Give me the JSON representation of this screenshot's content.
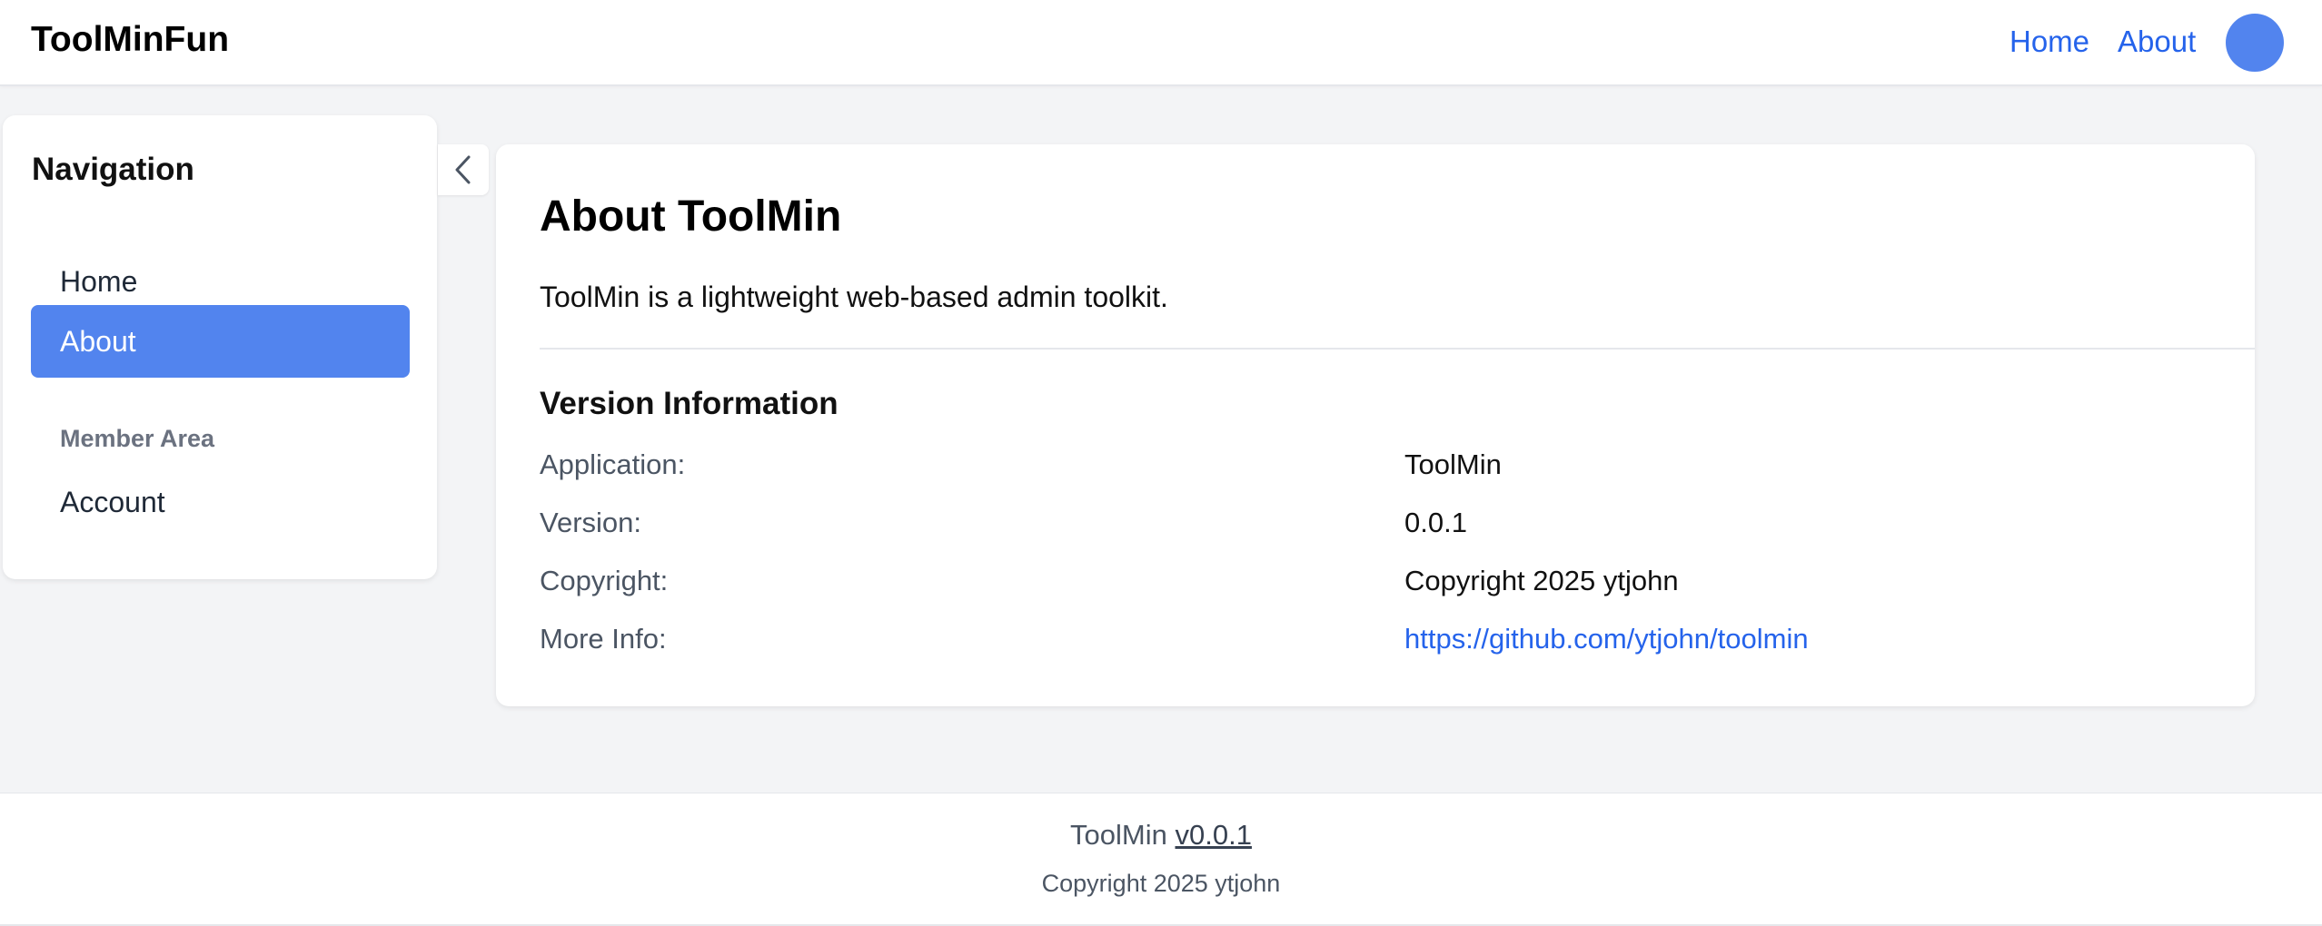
{
  "header": {
    "brand": "ToolMinFun",
    "nav": {
      "home": "Home",
      "about": "About"
    },
    "avatar_color": "#5284ee"
  },
  "sidebar": {
    "title": "Navigation",
    "items": [
      {
        "label": "Home",
        "active": false
      },
      {
        "label": "About",
        "active": true
      }
    ],
    "section": "Member Area",
    "member_items": [
      {
        "label": "Account",
        "active": false
      }
    ],
    "collapse_icon": "chevron-left-icon"
  },
  "main": {
    "title": "About ToolMin",
    "intro": "ToolMin is a lightweight web-based admin toolkit.",
    "version_section_title": "Version Information",
    "rows": [
      {
        "label": "Application:",
        "value": "ToolMin"
      },
      {
        "label": "Version:",
        "value": "0.0.1"
      },
      {
        "label": "Copyright:",
        "value": "Copyright 2025 ytjohn"
      },
      {
        "label": "More Info:",
        "value": "https://github.com/ytjohn/toolmin"
      }
    ]
  },
  "footer": {
    "app": "ToolMin",
    "version": "v0.0.1",
    "copyright": "Copyright 2025 ytjohn"
  },
  "colors": {
    "accent": "#5284ee",
    "link": "#2563eb",
    "background": "#f3f4f6"
  }
}
